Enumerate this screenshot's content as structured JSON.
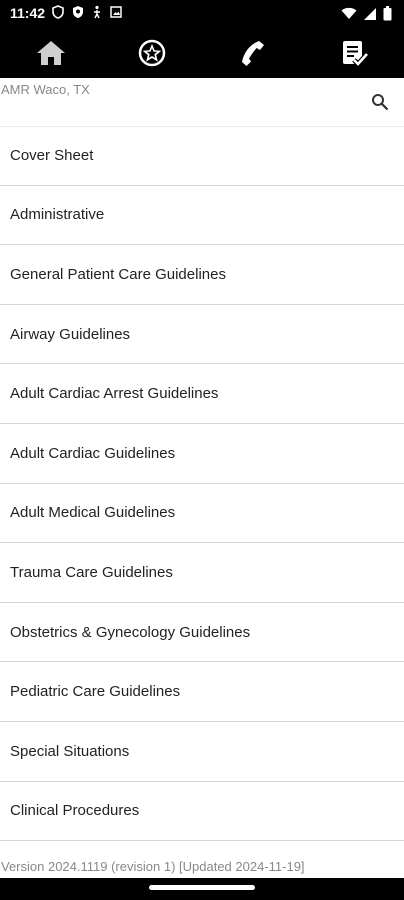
{
  "status_bar": {
    "time": "11:42",
    "left_icons": [
      "shield-icon",
      "shield-badge-icon",
      "accessibility-icon",
      "photo-icon"
    ],
    "right_icons": [
      "wifi-icon",
      "signal-icon",
      "battery-icon"
    ]
  },
  "tabs": [
    {
      "icon": "home-icon",
      "selected": true
    },
    {
      "icon": "star-icon",
      "selected": false
    },
    {
      "icon": "phone-icon",
      "selected": false
    },
    {
      "icon": "checklist-icon",
      "selected": false
    }
  ],
  "colors": {
    "accent": "#3cc7a8",
    "background": "#ffffff",
    "bar": "#000000",
    "text": "#222222",
    "muted_text": "#888888",
    "divider": "#d6d6d6"
  },
  "header": {
    "agency": "AMR Waco, TX"
  },
  "sections": [
    {
      "label": "Cover Sheet"
    },
    {
      "label": "Administrative"
    },
    {
      "label": "General Patient Care Guidelines"
    },
    {
      "label": "Airway Guidelines"
    },
    {
      "label": "Adult Cardiac Arrest Guidelines"
    },
    {
      "label": "Adult Cardiac Guidelines"
    },
    {
      "label": "Adult Medical Guidelines"
    },
    {
      "label": "Trauma Care Guidelines"
    },
    {
      "label": "Obstetrics & Gynecology Guidelines"
    },
    {
      "label": "Pediatric Care Guidelines"
    },
    {
      "label": "Special Situations"
    },
    {
      "label": "Clinical Procedures"
    }
  ],
  "footer": {
    "version": "Version 2024.1119 (revision 1) [Updated 2024-11-19]"
  }
}
